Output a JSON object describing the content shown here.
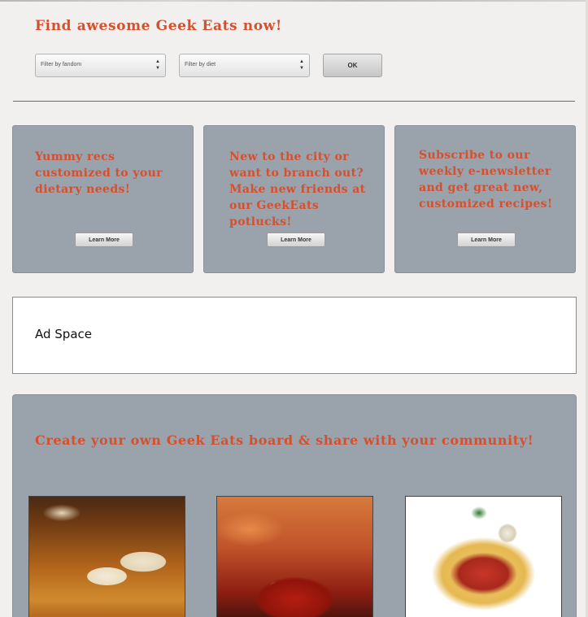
{
  "header": {
    "title": "Find awesome Geek Eats now!"
  },
  "filters": {
    "fandom_placeholder": "Filter by fandom",
    "diet_placeholder": "Filter by diet",
    "ok_label": "OK"
  },
  "cards": [
    {
      "text": "Yummy recs customized to your dietary needs!",
      "button": "Learn More"
    },
    {
      "text": "New to the city or want to branch out? Make new friends at our GeekEats potlucks!",
      "button": "Learn More"
    },
    {
      "text": "Subscribe to our weekly e-newsletter and get great new, customized recipes!",
      "button": "Learn More"
    }
  ],
  "ad": {
    "label": "Ad Space"
  },
  "board": {
    "title": "Create your own Geek Eats board & share with your community!",
    "photos": [
      "beer-photo",
      "wings-photo",
      "spaghetti-photo"
    ]
  },
  "colors": {
    "accent": "#d4502e",
    "card_bg": "#9aa2ab",
    "page_bg": "#f2f0ee"
  }
}
